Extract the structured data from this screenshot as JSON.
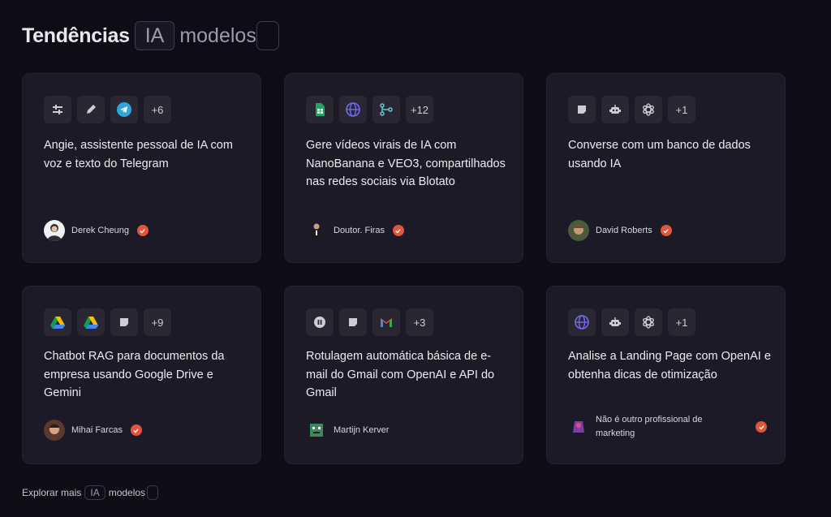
{
  "header": {
    "prefix": "Tendências",
    "pill": "IA",
    "suffix": "modelos"
  },
  "cards": [
    {
      "icons": [
        "sliders-icon",
        "pencil-icon",
        "telegram-icon"
      ],
      "more": "+6",
      "title": "Angie, assistente pessoal de IA com voz e texto do Telegram",
      "author": "Derek Cheung"
    },
    {
      "icons": [
        "google-sheets-icon",
        "globe-icon",
        "branch-icon"
      ],
      "more": "+12",
      "title": "Gere vídeos virais de IA com NanoBanana e VEO3, compartilhados nas redes sociais via Blotato",
      "author": "Doutor. Firas"
    },
    {
      "icons": [
        "sticky-note-icon",
        "robot-icon",
        "openai-icon"
      ],
      "more": "+1",
      "title": "Converse com um banco de dados usando IA",
      "author": "David Roberts"
    },
    {
      "icons": [
        "google-drive-icon",
        "google-drive-icon",
        "sticky-note-icon"
      ],
      "more": "+9",
      "title": "Chatbot RAG para documentos da empresa usando Google Drive e Gemini",
      "author": "Mihai Farcas"
    },
    {
      "icons": [
        "pause-icon",
        "sticky-note-icon",
        "gmail-icon"
      ],
      "more": "+3",
      "title": "Rotulagem automática básica de e-mail do Gmail com OpenAI e API do Gmail",
      "author": "Martijn Kerver"
    },
    {
      "icons": [
        "globe-icon",
        "robot-icon",
        "openai-icon"
      ],
      "more": "+1",
      "title": "Analise a Landing Page com OpenAI e obtenha dicas de otimização",
      "author": "Não é outro profissional de marketing"
    }
  ],
  "footer": {
    "prefix": "Explorar mais",
    "pill": "IA",
    "suffix": "modelos"
  },
  "colors": {
    "background": "#0f0c17",
    "card": "#1c1a26",
    "icon_tile": "#2a2733",
    "verified_badge": "#e0553b"
  }
}
